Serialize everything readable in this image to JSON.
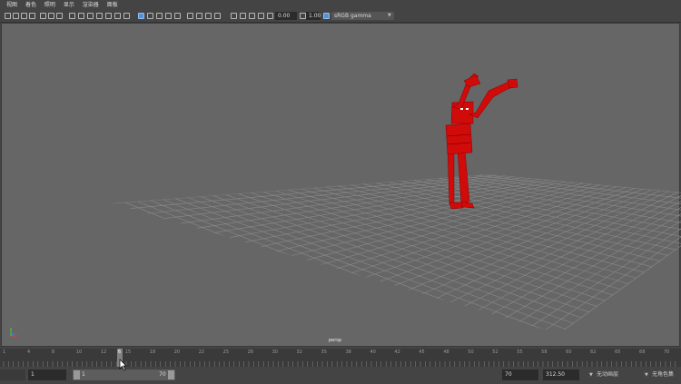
{
  "menu": [
    "视图",
    "着色",
    "照明",
    "显示",
    "渲染器",
    "面板"
  ],
  "toolbar": {
    "exposure": "0.00",
    "gamma": "1.00",
    "color_space": "sRGB gamma"
  },
  "viewport": {
    "camera_label": "persp"
  },
  "timeline": {
    "ticks": [
      "1",
      "4",
      "8",
      "10",
      "12",
      "15",
      "18",
      "20",
      "22",
      "25",
      "28",
      "30",
      "32",
      "35",
      "38",
      "40",
      "42",
      "45",
      "48",
      "50",
      "52",
      "55",
      "58",
      "60",
      "62",
      "65",
      "68",
      "70"
    ],
    "current_frame": "6"
  },
  "range": {
    "start": "1",
    "slider_start": "1",
    "slider_end": "70",
    "end": "70",
    "fps": "312.50",
    "anim_layer": "无动画层",
    "char_set": "无角色集"
  }
}
